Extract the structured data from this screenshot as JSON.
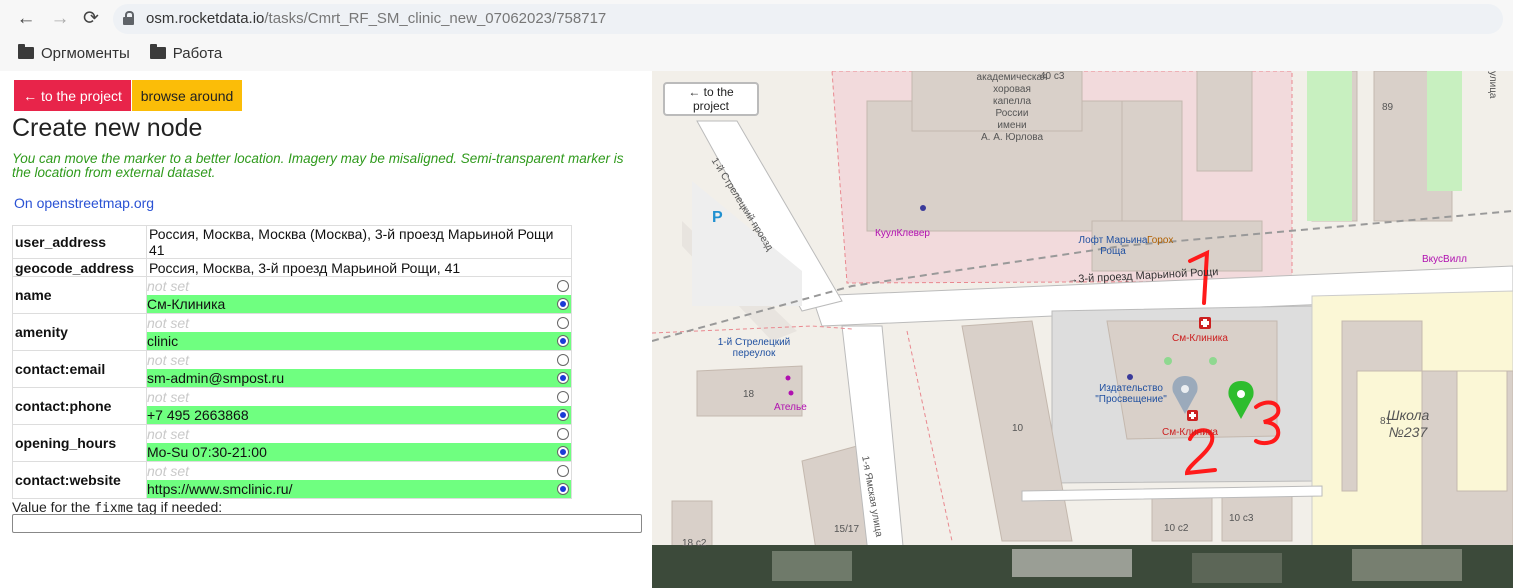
{
  "browser": {
    "url_host": "osm.rocketdata.io",
    "url_path": "/tasks/Cmrt_RF_SM_clinic_new_07062023/758717",
    "bookmarks": [
      "Оргмоменты",
      "Работа"
    ]
  },
  "toolbar": {
    "to_project": "← to the project",
    "browse_around": "browse around"
  },
  "page": {
    "title": "Create new node",
    "note": "You can move the marker to a better location. Imagery may be misaligned. Semi-transparent marker is the location from external dataset.",
    "osm_link": "On openstreetmap.org"
  },
  "addresses": [
    {
      "key": "user_address",
      "value": "Россия, Москва, Москва (Москва), 3-й проезд Марьиной Рощи 41"
    },
    {
      "key": "geocode_address",
      "value": "Россия, Москва, 3-й проезд Марьиной Рощи, 41"
    }
  ],
  "not_set_label": "not set",
  "tags": [
    {
      "key": "name",
      "value": "См-Клиника"
    },
    {
      "key": "amenity",
      "value": "clinic"
    },
    {
      "key": "contact:email",
      "value": "sm-admin@smpost.ru"
    },
    {
      "key": "contact:phone",
      "value": "+7 495 2663868"
    },
    {
      "key": "opening_hours",
      "value": "Mo-Su 07:30-21:00"
    },
    {
      "key": "contact:website",
      "value": "https://www.smclinic.ru/"
    }
  ],
  "fixme": {
    "label_pre": "Value for the ",
    "label_code": "fixme",
    "label_post": " tag if needed:",
    "value": ""
  },
  "map": {
    "to_project": "← to the project",
    "labels": {
      "choir": [
        "академическая",
        "хоровая",
        "капелла",
        "России",
        "имени",
        "А. А. Юрлова"
      ],
      "street_strel_proezd": "1-й Стрелецкий проезд",
      "kuulklever": "КуулКлевер",
      "loft": [
        "Лофт Марьина",
        "Роща"
      ],
      "gorokh": "Горох",
      "vkusvill": "ВкусВилл",
      "street_3y": "→3-й проезд Марьиной Рощи",
      "sm_clinic_top": "См-Клиника",
      "sm_clinic_bottom": "См-Клиника",
      "publisher": [
        "Издательство",
        "\"Просвещение\""
      ],
      "strel_pereulok": [
        "1-й Стрелецкий",
        "переулок"
      ],
      "atelie": "Ателье",
      "school": [
        "Школа",
        "№237"
      ],
      "street_yamskaya": "1-я Ямская улица",
      "ulitsa_edge": "улица",
      "house_40c3": "40 с3",
      "house_89": "89",
      "house_18": "18",
      "house_10": "10",
      "house_81": "81",
      "house_15_17": "15/17",
      "house_10c2": "10 с2",
      "house_10c3": "10 с3",
      "house_18c2": "18 с2",
      "parking": "P"
    },
    "annotations": [
      "1",
      "2",
      "3"
    ],
    "colors": {
      "marker_green": "#2ebd2e",
      "marker_gray": "#8fa3b8",
      "annotation": "#ff1a1a"
    }
  }
}
